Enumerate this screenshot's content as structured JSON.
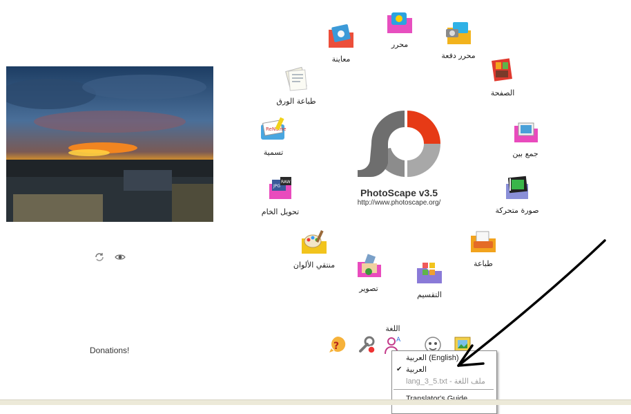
{
  "app": {
    "title": "PhotoScape v3.5",
    "url": "http://www.photoscape.org/"
  },
  "donations": "Donations!",
  "menu": {
    "editor": "محرر",
    "batch_editor": "محرر دفعة",
    "viewer": "معاينة",
    "page": "الصفحة",
    "print_paper": "طباعة الورق",
    "combine": "جمع بين",
    "rename": "تسمية",
    "animated_gif": "صورة متحركة",
    "raw_converter": "تحويل الخام",
    "print": "طباعة",
    "color_picker": "منتقي الألوان",
    "screen_capture": "تصوير",
    "splitter": "التقسيم"
  },
  "bottom": {
    "language_label": "اللغة"
  },
  "language_menu": {
    "items": [
      {
        "label": "العربية (English)",
        "checked": false,
        "enabled": true
      },
      {
        "label": "العربية",
        "checked": true,
        "enabled": true
      },
      {
        "label": "lang_3_5.txt - ملف اللغة",
        "checked": false,
        "enabled": false
      }
    ],
    "footer_item": "Translator's Guide"
  },
  "colors": {
    "logo_red": "#e63a16",
    "logo_gray": "#6e6e6e",
    "logo_light": "#a8a8a8",
    "arrow": "#000000"
  }
}
